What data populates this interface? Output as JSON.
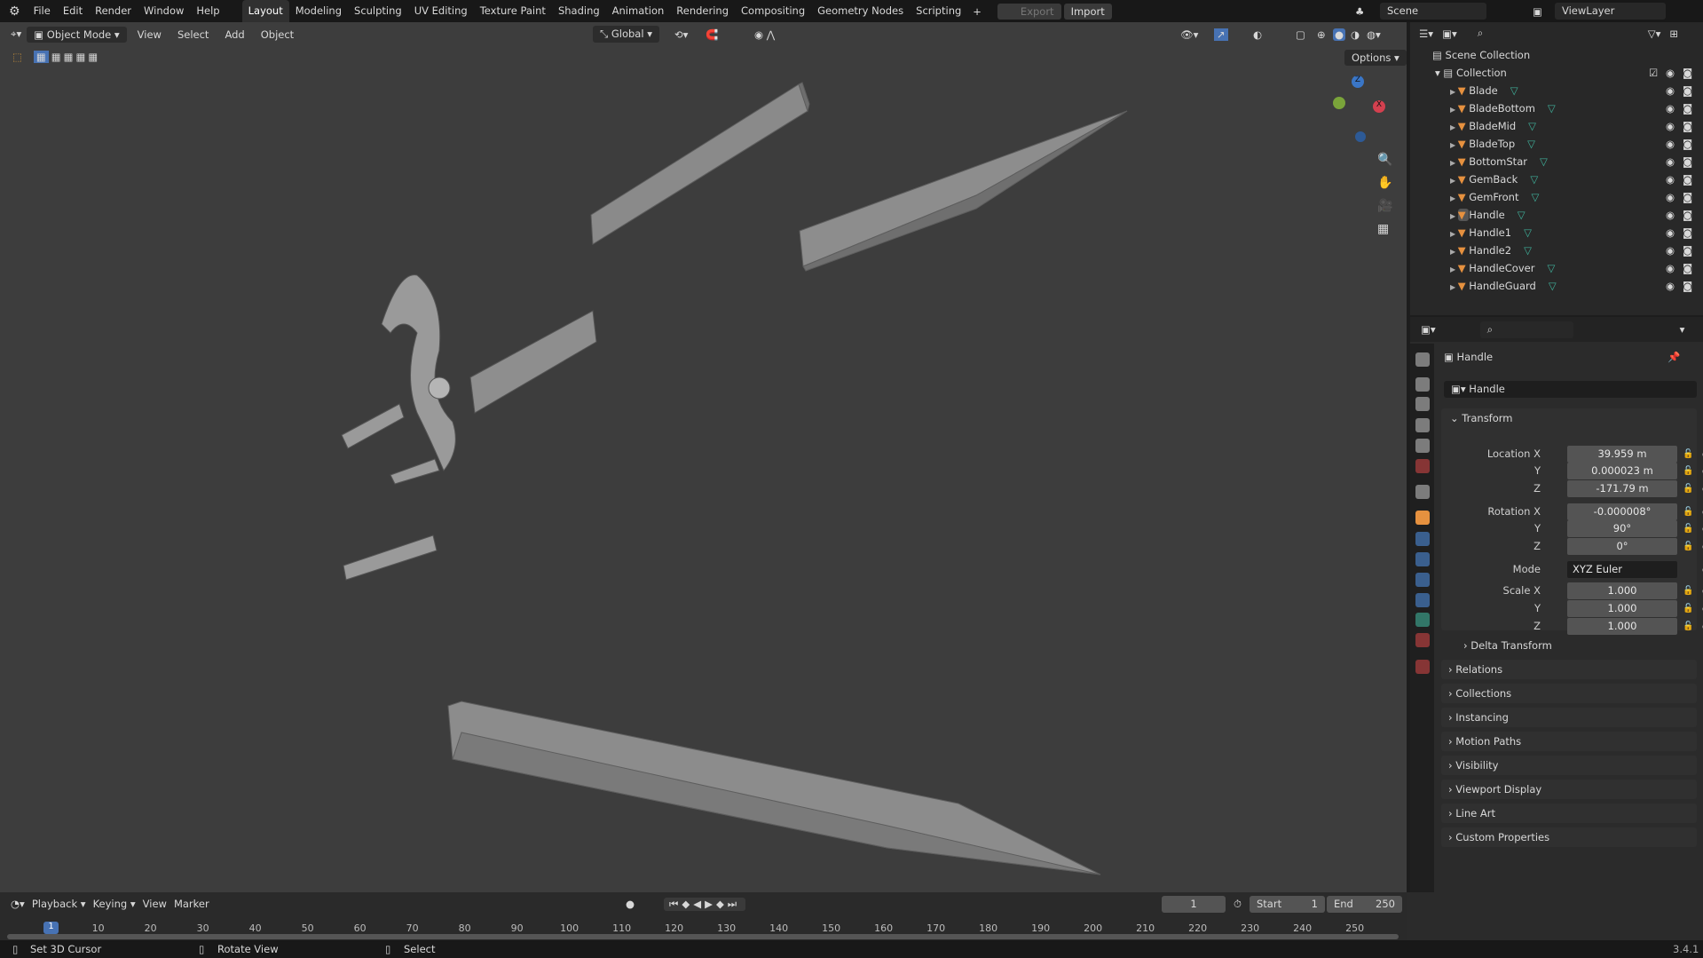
{
  "topbar": {
    "menus": [
      "File",
      "Edit",
      "Render",
      "Window",
      "Help"
    ],
    "workspaces": [
      "Layout",
      "Modeling",
      "Sculpting",
      "UV Editing",
      "Texture Paint",
      "Shading",
      "Animation",
      "Rendering",
      "Compositing",
      "Geometry Nodes",
      "Scripting"
    ],
    "add": "+",
    "export": "Export",
    "import": "Import",
    "scene": "Scene",
    "view_layer": "ViewLayer"
  },
  "viewport": {
    "mode": "Object Mode",
    "menus": [
      "View",
      "Select",
      "Add",
      "Object"
    ],
    "orientation": "Global",
    "options": "Options",
    "gizmo": {
      "x": "X",
      "y": "Y",
      "z": "Z"
    }
  },
  "outliner": {
    "scene_collection": "Scene Collection",
    "collection": "Collection",
    "items": [
      "Blade",
      "BladeBottom",
      "BladeMid",
      "BladeTop",
      "BottomStar",
      "GemBack",
      "GemFront",
      "Handle",
      "Handle1",
      "Handle2",
      "HandleCover",
      "HandleGuard"
    ],
    "selected": "Handle"
  },
  "properties": {
    "object_name": "Handle",
    "data_name": "Handle",
    "transform_label": "Transform",
    "location": {
      "label": "Location X",
      "x": "39.959 m",
      "y": "0.000023 m",
      "z": "-171.79 m"
    },
    "rotation": {
      "label": "Rotation X",
      "x": "-0.000008°",
      "y": "90°",
      "z": "0°"
    },
    "mode": {
      "label": "Mode",
      "value": "XYZ Euler"
    },
    "scale": {
      "label": "Scale X",
      "x": "1.000",
      "y": "1.000",
      "z": "1.000"
    },
    "axis_y": "Y",
    "axis_z": "Z",
    "delta": "Delta Transform",
    "sections": [
      "Relations",
      "Collections",
      "Instancing",
      "Motion Paths",
      "Visibility",
      "Viewport Display",
      "Line Art",
      "Custom Properties"
    ]
  },
  "timeline": {
    "menus": [
      "Playback",
      "Keying",
      "View",
      "Marker"
    ],
    "current_frame": "1",
    "start_label": "Start",
    "start": "1",
    "end_label": "End",
    "end": "250",
    "ticks": [
      "10",
      "20",
      "30",
      "40",
      "50",
      "60",
      "70",
      "80",
      "90",
      "100",
      "110",
      "120",
      "130",
      "140",
      "150",
      "160",
      "170",
      "180",
      "190",
      "200",
      "210",
      "220",
      "230",
      "240",
      "250"
    ]
  },
  "status": {
    "left": "Set 3D Cursor",
    "middle": "Rotate View",
    "right": "Select",
    "version": "3.4.1"
  },
  "colors": {
    "accent": "#4772b3",
    "object_orange": "#e6913f",
    "mesh_green": "#3fb09a"
  }
}
